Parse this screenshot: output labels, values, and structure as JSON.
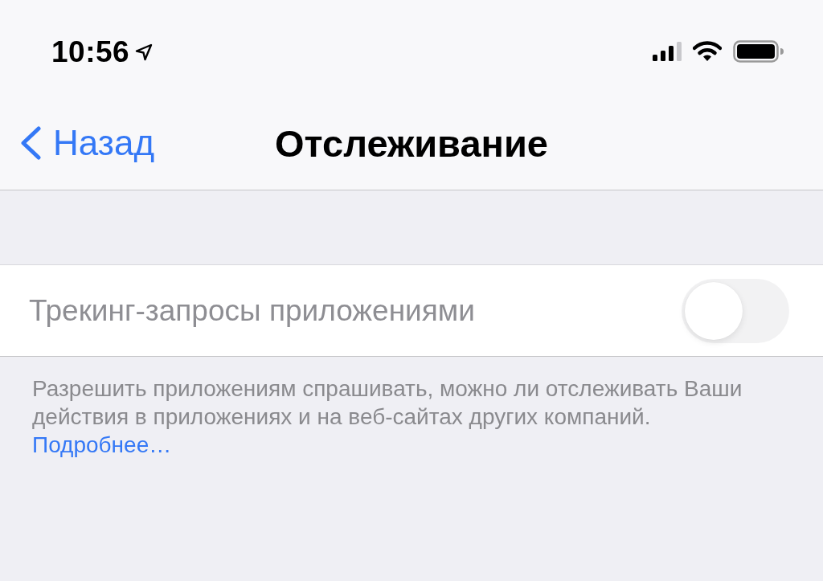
{
  "status_bar": {
    "time": "10:56"
  },
  "nav": {
    "back_label": "Назад",
    "title": "Отслеживание"
  },
  "setting": {
    "label": "Трекинг-запросы приложениями",
    "on": false,
    "disabled": true
  },
  "footer": {
    "text": "Разрешить приложениям спрашивать, можно ли отслеживать Ваши действия в приложениях и на веб-сайтах других компаний.",
    "link": "Подробнее…"
  }
}
